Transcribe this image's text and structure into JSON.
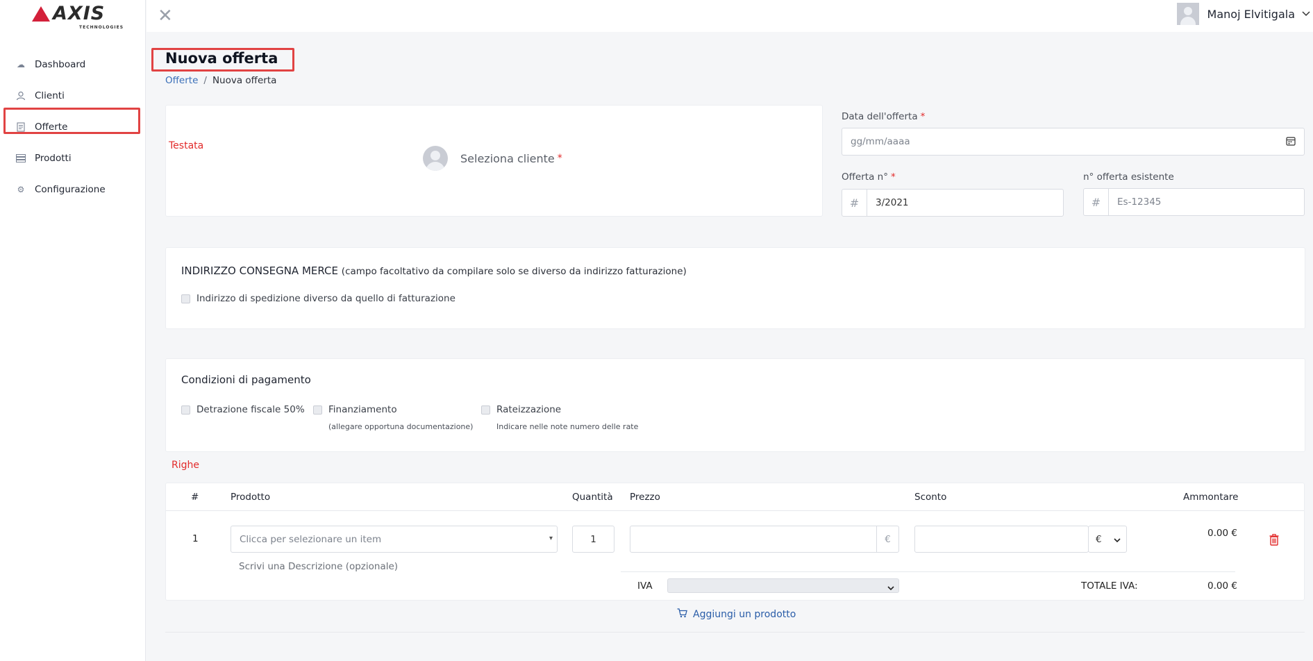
{
  "brand": {
    "name": "AXIS",
    "tagline": "TECHNOLOGIES"
  },
  "sidebar": {
    "items": [
      {
        "label": "Dashboard",
        "icon": "cloud-icon"
      },
      {
        "label": "Clienti",
        "icon": "user-icon"
      },
      {
        "label": "Offerte",
        "icon": "document-icon",
        "active": true
      },
      {
        "label": "Prodotti",
        "icon": "list-icon"
      },
      {
        "label": "Configurazione",
        "icon": "gear-icon"
      }
    ]
  },
  "topbar": {
    "close": "✕",
    "user_name": "Manoj Elvitigala",
    "chevron": "⌄"
  },
  "page": {
    "title": "Nuova offerta",
    "breadcrumb": {
      "parent": "Offerte",
      "separator": "/",
      "current": "Nuova offerta"
    }
  },
  "header_section": {
    "annotation": "Testata",
    "select_client": "Seleziona cliente",
    "required_mark": "*",
    "date_label": "Data dell'offerta",
    "date_placeholder": "gg/mm/aaaa",
    "offer_no_label": "Offerta n°",
    "offer_no_value": "3/2021",
    "existing_label": "n° offerta esistente",
    "existing_placeholder": "Es-12345",
    "hash": "#"
  },
  "address_section": {
    "title": "INDIRIZZO CONSEGNA MERCE",
    "subtitle": "(campo facoltativo da compilare solo se diverso da indirizzo fatturazione)",
    "checkbox_label": "Indirizzo di spedizione diverso da quello di fatturazione"
  },
  "payment_section": {
    "title": "Condizioni di pagamento",
    "options": [
      {
        "label": "Detrazione fiscale 50%",
        "sub": ""
      },
      {
        "label": "Finanziamento",
        "sub": "(allegare opportuna documentazione)"
      },
      {
        "label": "Rateizzazione",
        "sub": "Indicare nelle note numero delle rate"
      }
    ]
  },
  "rows_section": {
    "annotation": "Righe",
    "headers": {
      "num": "#",
      "product": "Prodotto",
      "qty": "Quantità",
      "price": "Prezzo",
      "discount": "Sconto",
      "amount": "Ammontare"
    },
    "row": {
      "num": "1",
      "product_placeholder": "Clicca per selezionare un item",
      "description_placeholder": "Scrivi una Descrizione (opzionale)",
      "qty": "1",
      "currency": "€",
      "discount_type": "€",
      "amount": "0.00 €",
      "iva_label": "IVA",
      "total_iva_label": "TOTALE IVA:",
      "total_iva": "0.00 €"
    },
    "add_product": "Aggiungi un prodotto"
  }
}
